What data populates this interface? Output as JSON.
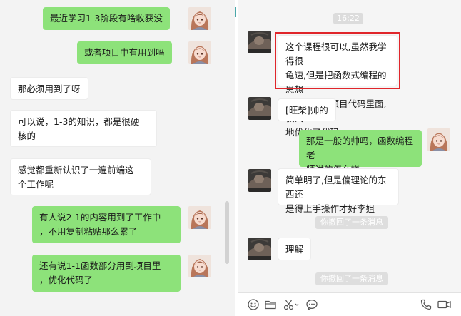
{
  "left_chat": {
    "messages": [
      {
        "side": "out",
        "text": "最近学习1-3阶段有啥收获没"
      },
      {
        "side": "out",
        "text": "或者项目中有用到吗"
      },
      {
        "side": "in",
        "text": "那必须用到了呀"
      },
      {
        "side": "in",
        "text": "可以说，1-3的知识，都是很硬\n核的"
      },
      {
        "side": "in",
        "text": "感觉都重新认识了一遍前端这\n个工作呢"
      },
      {
        "side": "out",
        "text": "有人说2-1的内容用到了工作中\n，不用复制粘贴那么累了"
      },
      {
        "side": "out",
        "text": "还有说1-1函数部分用到项目里\n，优化代码了"
      }
    ]
  },
  "right_chat": {
    "timestamp": "16:22",
    "messages": [
      {
        "side": "in",
        "text": "这个课程很可以,虽然我学得很\n龟速,但是把函数式编程的思想\n用进了我的项目代码里面,极大\n地优化了代码",
        "highlighted": true
      },
      {
        "side": "in",
        "text": "[旺柴]帅的"
      },
      {
        "side": "out",
        "text": "那是一般的帅吗，函数编程老\n师讲的怎么样"
      },
      {
        "side": "in",
        "text": "简单明了,但是偏理论的东西还\n是得上手操作才好李姐"
      },
      {
        "side": "system",
        "text": "你撤回了一条消息"
      },
      {
        "side": "in",
        "text": "理解"
      },
      {
        "side": "system",
        "text": "你撤回了一条消息"
      }
    ]
  },
  "toolbar": {
    "icons": [
      "emoji-icon",
      "folder-icon",
      "scissors-icon",
      "chat-bubble-icon",
      "phone-icon",
      "video-call-icon"
    ]
  },
  "colors": {
    "outgoing_bubble": "#8de27a",
    "highlight_border": "#e0262b",
    "divider_accent": "#4aa7a9"
  }
}
